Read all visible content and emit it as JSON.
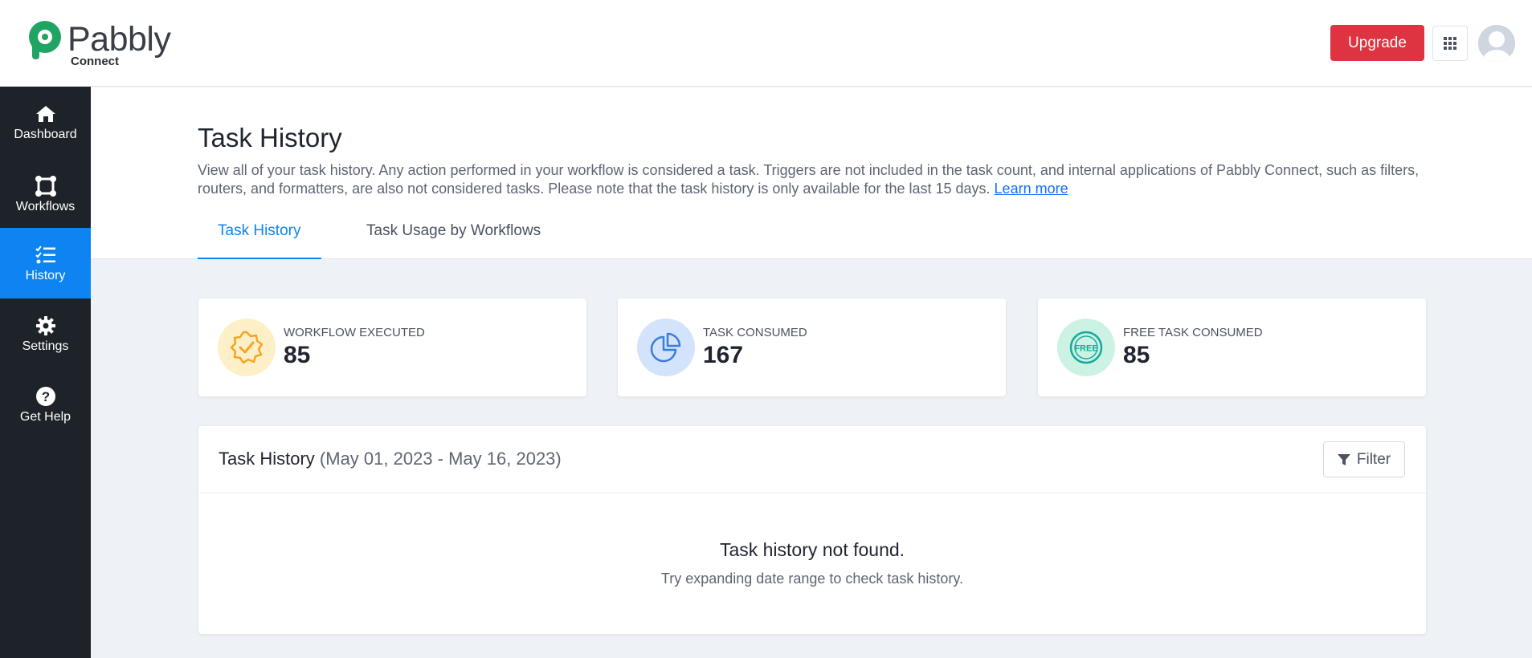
{
  "header": {
    "logo_text": "Pabbly",
    "logo_sub": "Connect",
    "upgrade_label": "Upgrade",
    "apps_icon": "grid-icon",
    "avatar_icon": "user-avatar-icon",
    "accent_color": "#de3341"
  },
  "sidebar": {
    "background": "#1e2329",
    "active_color": "#0d84f2",
    "items": [
      {
        "label": "Dashboard",
        "icon": "home-icon"
      },
      {
        "label": "Workflows",
        "icon": "workflow-icon"
      },
      {
        "label": "History",
        "icon": "checklist-icon",
        "active": true
      },
      {
        "label": "Settings",
        "icon": "gear-icon"
      },
      {
        "label": "Get Help",
        "icon": "question-icon"
      }
    ]
  },
  "page": {
    "title": "Task History",
    "description": "View all of your task history. Any action performed in your workflow is considered a task. Triggers are not included in the task count, and internal applications of Pabbly Connect, such as filters, routers, and formatters, are also not considered tasks. Please note that the task history is only available for the last 15 days.",
    "learn_more": "Learn more",
    "tabs": [
      {
        "label": "Task History",
        "active": true
      },
      {
        "label": "Task Usage by Workflows",
        "active": false
      }
    ]
  },
  "stats": [
    {
      "label": "WORKFLOW EXECUTED",
      "value": "85",
      "icon": "badge-check-icon",
      "color": "#f5a524"
    },
    {
      "label": "TASK CONSUMED",
      "value": "167",
      "icon": "pie-chart-icon",
      "color": "#3b7dd8"
    },
    {
      "label": "FREE TASK CONSUMED",
      "value": "85",
      "icon": "free-badge-icon",
      "color": "#17a99a"
    }
  ],
  "history_panel": {
    "title": "Task History",
    "range": "(May 01, 2023 - May 16, 2023)",
    "filter_label": "Filter",
    "empty_title": "Task history not found.",
    "empty_subtitle": "Try expanding date range to check task history."
  }
}
